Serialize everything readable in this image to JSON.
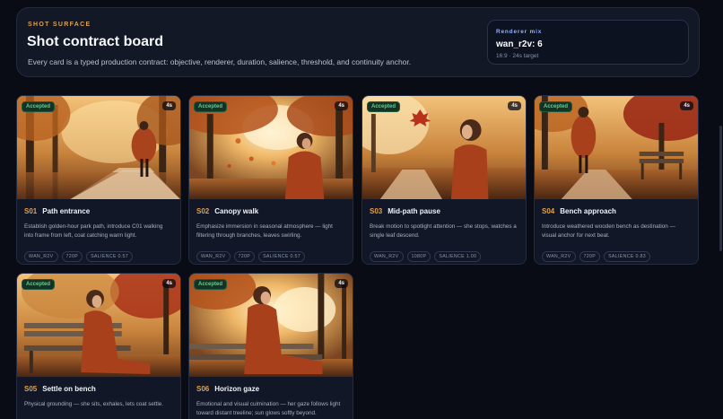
{
  "header": {
    "kicker": "SHOT SURFACE",
    "title": "Shot contract board",
    "subtitle": "Every card is a typed production contract: objective, renderer, duration, salience, threshold, and continuity anchor.",
    "mix_label": "Renderer mix",
    "mix_value": "wan_r2v: 6",
    "mix_sub": "16:9 · 24s target"
  },
  "cards": [
    {
      "status": "Accepted",
      "duration": "4s",
      "id": "S01",
      "title": "Path entrance",
      "desc": "Establish golden-hour park path, introduce C01 walking into frame from left, coat catching warm light.",
      "chips": [
        "WAN_R2V",
        "720P",
        "SALIENCE 0.57"
      ]
    },
    {
      "status": "Accepted",
      "duration": "4s",
      "id": "S02",
      "title": "Canopy walk",
      "desc": "Emphasize immersion in seasonal atmosphere — light filtering through branches, leaves swirling.",
      "chips": [
        "WAN_R2V",
        "720P",
        "SALIENCE 0.57"
      ]
    },
    {
      "status": "Accepted",
      "duration": "4s",
      "id": "S03",
      "title": "Mid-path pause",
      "desc": "Break motion to spotlight attention — she stops, watches a single leaf descend.",
      "chips": [
        "WAN_R2V",
        "1080P",
        "SALIENCE 1.00"
      ]
    },
    {
      "status": "Accepted",
      "duration": "4s",
      "id": "S04",
      "title": "Bench approach",
      "desc": "Introduce weathered wooden bench as destination — visual anchor for next beat.",
      "chips": [
        "WAN_R2V",
        "720P",
        "SALIENCE 0.83"
      ]
    },
    {
      "status": "Accepted",
      "duration": "4s",
      "id": "S05",
      "title": "Settle on bench",
      "desc": "Physical grounding — she sits, exhales, lets coat settle.",
      "chips": []
    },
    {
      "status": "Accepted",
      "duration": "4s",
      "id": "S06",
      "title": "Horizon gaze",
      "desc": "Emotional and visual culmination — her gaze follows light toward distant treeline; sun glows softly beyond.",
      "chips": []
    }
  ]
}
